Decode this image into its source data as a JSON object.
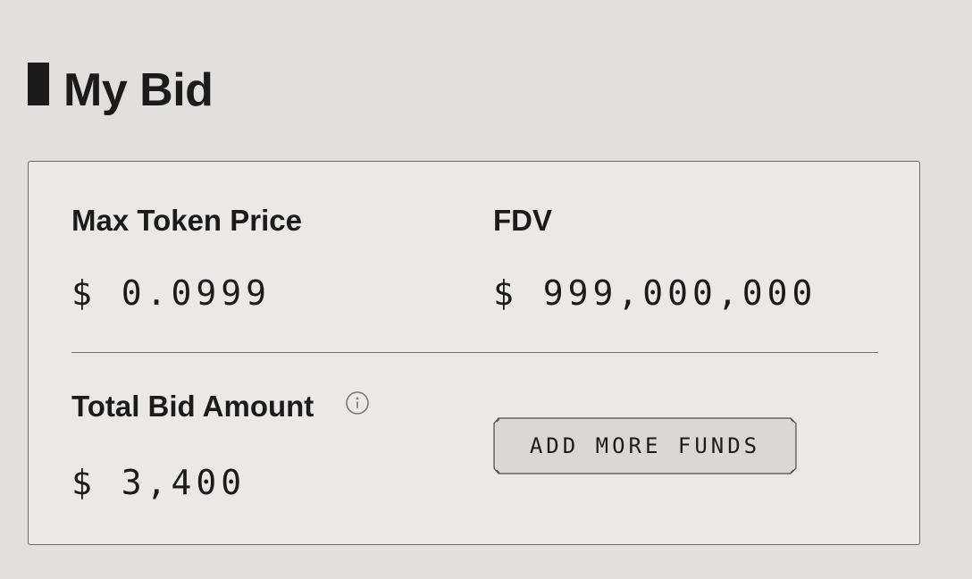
{
  "header": {
    "title": "My Bid"
  },
  "bid": {
    "max_token_price_label": "Max Token Price",
    "max_token_price_value": "$ 0.0999",
    "fdv_label": "FDV",
    "fdv_value": "$ 999,000,000",
    "total_bid_amount_label": "Total Bid Amount",
    "total_bid_amount_value": "$ 3,400",
    "info_icon": "info-circle-icon",
    "add_funds_label": "ADD MORE FUNDS"
  },
  "colors": {
    "background": "#e1e0df",
    "card_background": "#eae9e8",
    "text": "#1b1b1b",
    "button_background": "#dbd7d6"
  }
}
